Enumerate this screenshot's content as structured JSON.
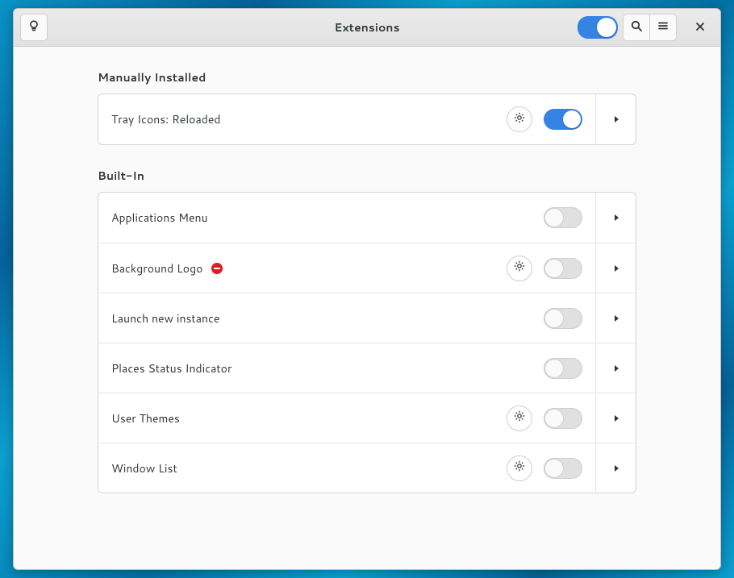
{
  "header": {
    "title": "Extensions",
    "global_switch_on": true
  },
  "sections": {
    "manual": {
      "title": "Manually Installed",
      "items": [
        {
          "name": "Tray Icons: Reloaded",
          "enabled": true,
          "has_prefs": true,
          "has_error": false
        }
      ]
    },
    "builtin": {
      "title": "Built-In",
      "items": [
        {
          "name": "Applications Menu",
          "enabled": false,
          "has_prefs": false,
          "has_error": false
        },
        {
          "name": "Background Logo",
          "enabled": false,
          "has_prefs": true,
          "has_error": true
        },
        {
          "name": "Launch new instance",
          "enabled": false,
          "has_prefs": false,
          "has_error": false
        },
        {
          "name": "Places Status Indicator",
          "enabled": false,
          "has_prefs": false,
          "has_error": false
        },
        {
          "name": "User Themes",
          "enabled": false,
          "has_prefs": true,
          "has_error": false
        },
        {
          "name": "Window List",
          "enabled": false,
          "has_prefs": true,
          "has_error": false
        }
      ]
    }
  }
}
